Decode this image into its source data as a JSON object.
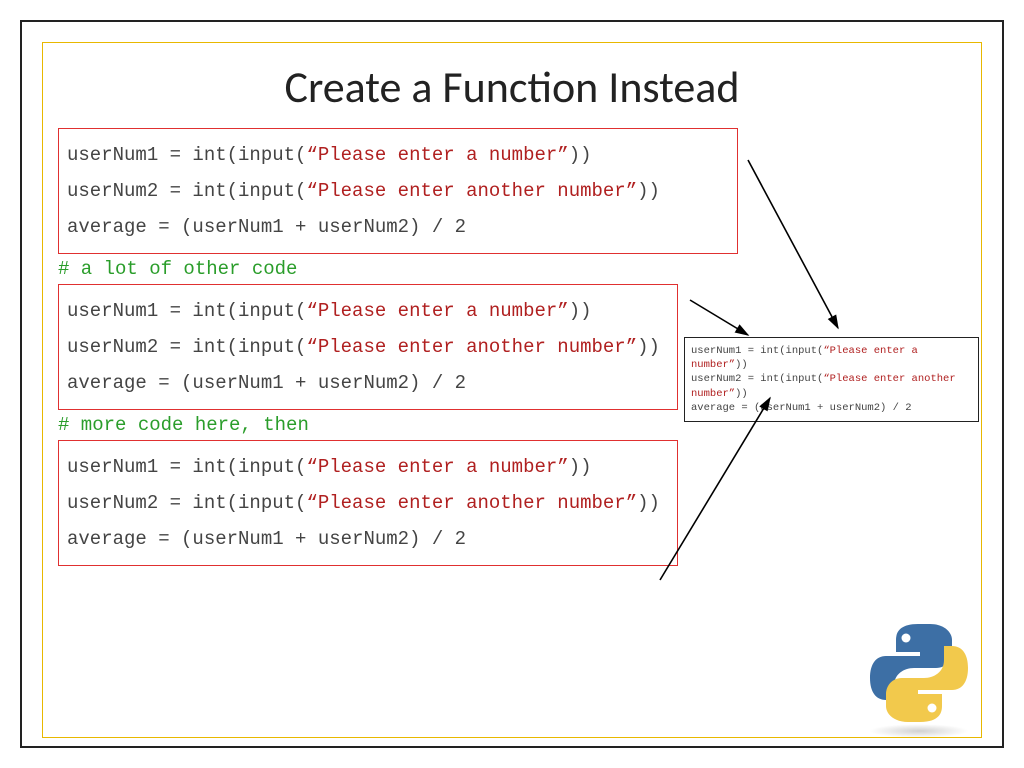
{
  "title": "Create a Function Instead",
  "blocks": [
    {
      "lines": [
        {
          "pre": "userNum1 = int(input(",
          "str": "“Please enter a number”",
          "post": "))"
        },
        {
          "pre": "userNum2 = int(input(",
          "str": "“Please enter another number”",
          "post": "))"
        },
        {
          "pre": "average = (userNum1 + userNum2) / 2",
          "str": "",
          "post": ""
        }
      ]
    },
    {
      "lines": [
        {
          "pre": "userNum1 = int(input(",
          "str": "“Please enter a number”",
          "post": "))"
        },
        {
          "pre": "userNum2 = int(input(",
          "str": "“Please enter another number”",
          "post": "))"
        },
        {
          "pre": "average = (userNum1 + userNum2) / 2",
          "str": "",
          "post": ""
        }
      ]
    },
    {
      "lines": [
        {
          "pre": "userNum1 = int(input(",
          "str": "“Please enter a number”",
          "post": "))"
        },
        {
          "pre": "userNum2 = int(input(",
          "str": "“Please enter another number”",
          "post": "))"
        },
        {
          "pre": "average = (userNum1 + userNum2) / 2",
          "str": "",
          "post": ""
        }
      ]
    }
  ],
  "comments": [
    "# a lot of other code",
    "# more code here, then"
  ],
  "function_box": {
    "lines": [
      {
        "pre": "userNum1 = int(input(",
        "str": "“Please enter a number”",
        "post": "))"
      },
      {
        "pre": "userNum2 = int(input(",
        "str": "“Please enter another number”",
        "post": "))"
      },
      {
        "pre": "average = (userNum1 + userNum2) / 2",
        "str": "",
        "post": ""
      }
    ]
  },
  "colors": {
    "string": "#b02020",
    "comment": "#2a9d2a",
    "frame_inner": "#e8b800",
    "box_border": "#e03030"
  }
}
